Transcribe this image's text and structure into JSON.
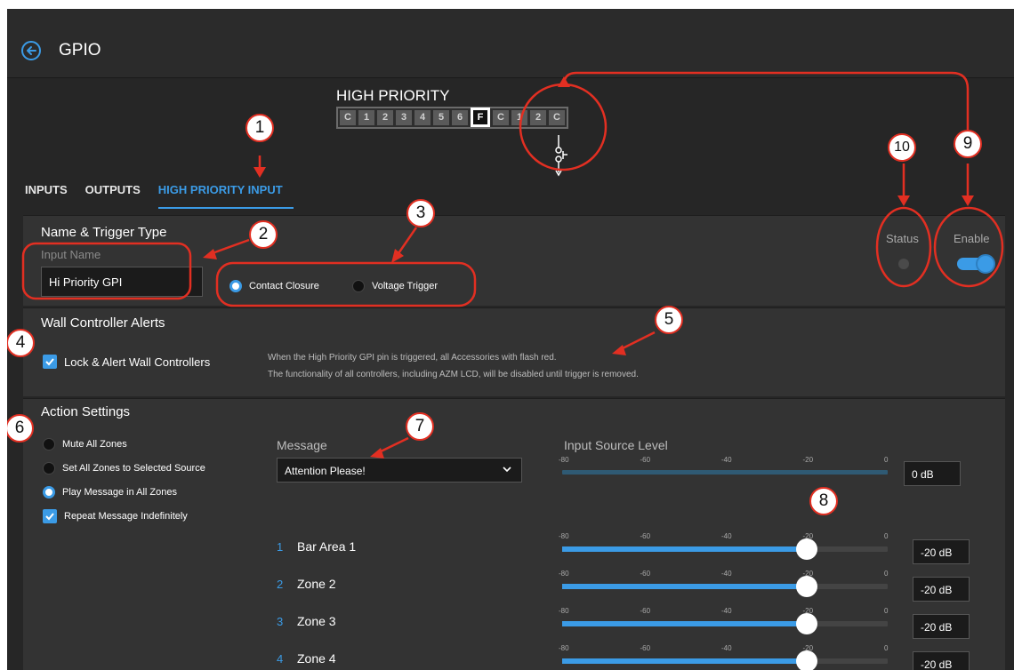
{
  "header": {
    "title": "GPIO",
    "back_icon": "arrow-left-circle-icon"
  },
  "priority_strip": {
    "label": "HIGH PRIORITY",
    "pins": [
      "C",
      "1",
      "2",
      "3",
      "4",
      "5",
      "6",
      "F",
      "C",
      "1",
      "2",
      "C"
    ],
    "active_pin": "F"
  },
  "tabs": [
    {
      "label": "INPUTS",
      "selected": false
    },
    {
      "label": "OUTPUTS",
      "selected": false
    },
    {
      "label": "HIGH PRIORITY INPUT",
      "selected": true
    }
  ],
  "name_trigger": {
    "title": "Name & Trigger Type",
    "input_label": "Input Name",
    "input_value": "Hi Priority GPI",
    "trigger_options": [
      {
        "label": "Contact Closure",
        "selected": true
      },
      {
        "label": "Voltage Trigger",
        "selected": false
      }
    ],
    "status_label": "Status",
    "enable_label": "Enable",
    "enabled": true
  },
  "wall_alerts": {
    "title": "Wall Controller Alerts",
    "checkbox_label": "Lock & Alert Wall Controllers",
    "checked": true,
    "info_line1": "When the High Priority GPI pin is triggered, all Accessories with flash red.",
    "info_line2": "The functionality of all controllers, including AZM LCD, will be disabled until trigger is removed."
  },
  "action_settings": {
    "title": "Action Settings",
    "options": [
      {
        "label": "Mute All Zones",
        "selected": false
      },
      {
        "label": "Set All Zones to Selected Source",
        "selected": false
      },
      {
        "label": "Play Message in All Zones",
        "selected": true
      }
    ],
    "repeat_label": "Repeat Message Indefinitely",
    "repeat_checked": true,
    "message_label": "Message",
    "message_value": "Attention Please!",
    "source_level_label": "Input Source Level",
    "source_level_value": "0 dB",
    "source_level_db": 0,
    "scale_ticks": [
      "-80",
      "-60",
      "-40",
      "-20",
      "0"
    ],
    "zones": [
      {
        "num": "1",
        "name": "Bar Area 1",
        "level": "-20 dB",
        "db": -20
      },
      {
        "num": "2",
        "name": "Zone 2",
        "level": "-20 dB",
        "db": -20
      },
      {
        "num": "3",
        "name": "Zone 3",
        "level": "-20 dB",
        "db": -20
      },
      {
        "num": "4",
        "name": "Zone 4",
        "level": "-20 dB",
        "db": -20
      }
    ]
  },
  "annotations": [
    "1",
    "2",
    "3",
    "4",
    "5",
    "6",
    "7",
    "8",
    "9",
    "10"
  ],
  "colors": {
    "accent": "#3b9be6",
    "callout_red": "#e22f22",
    "background": "#262626"
  }
}
